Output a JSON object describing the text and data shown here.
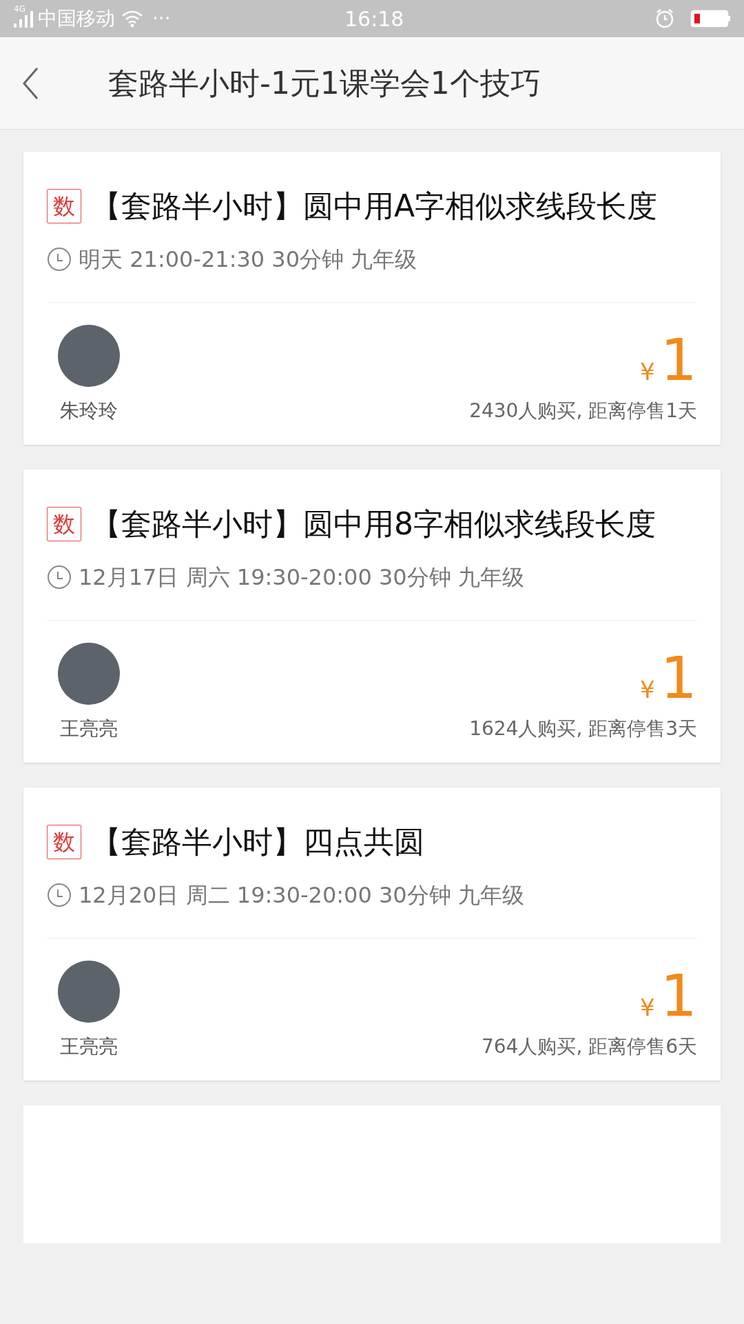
{
  "status_bar": {
    "network": "4G",
    "carrier": "中国移动",
    "more": "···",
    "time": "16:18"
  },
  "nav": {
    "title": "套路半小时-1元1课学会1个技巧"
  },
  "courses": [
    {
      "subject": "数",
      "title": "【套路半小时】圆中用A字相似求线段长度",
      "schedule": "明天 21:00-21:30 30分钟 九年级",
      "teacher": "朱玲玲",
      "currency": "¥",
      "price": "1",
      "sales": "2430人购买, 距离停售1天"
    },
    {
      "subject": "数",
      "title": "【套路半小时】圆中用8字相似求线段长度",
      "schedule": "12月17日 周六 19:30-20:00 30分钟 九年级",
      "teacher": "王亮亮",
      "currency": "¥",
      "price": "1",
      "sales": "1624人购买, 距离停售3天"
    },
    {
      "subject": "数",
      "title": "【套路半小时】四点共圆",
      "schedule": "12月20日 周二 19:30-20:00 30分钟 九年级",
      "teacher": "王亮亮",
      "currency": "¥",
      "price": "1",
      "sales": "764人购买, 距离停售6天"
    }
  ]
}
